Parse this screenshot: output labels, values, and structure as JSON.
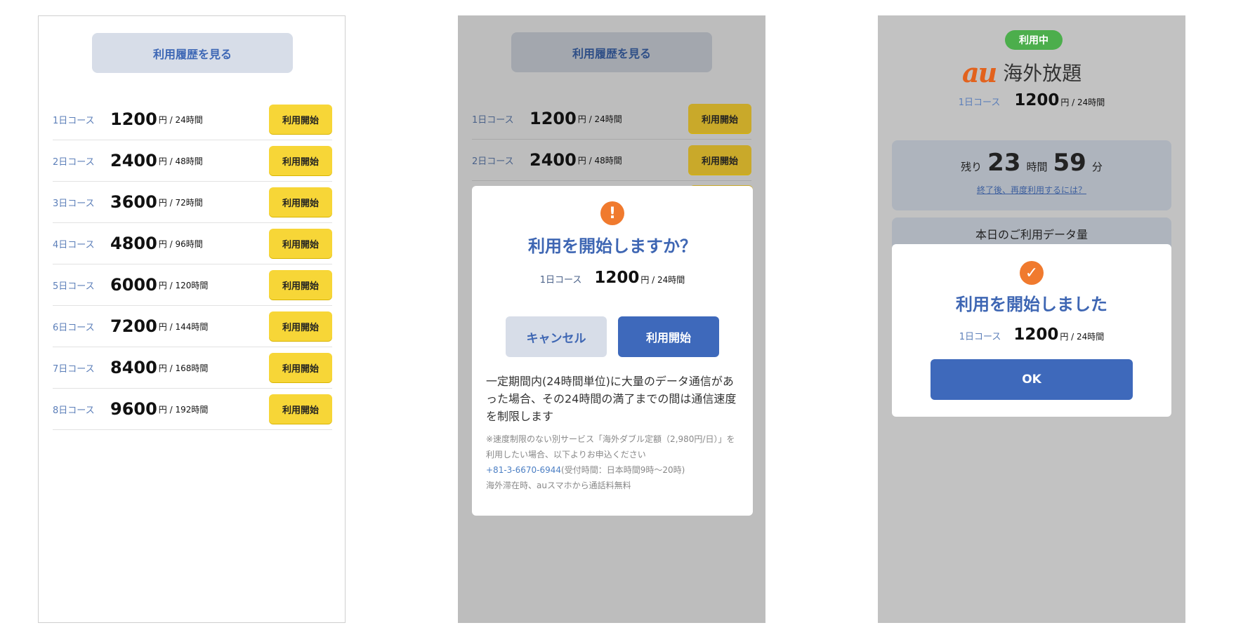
{
  "history_button": "利用履歴を見る",
  "start_label": "利用開始",
  "courses": [
    {
      "label": "1日コース",
      "price": "1200",
      "unit": "円 / 24時間"
    },
    {
      "label": "2日コース",
      "price": "2400",
      "unit": "円 / 48時間"
    },
    {
      "label": "3日コース",
      "price": "3600",
      "unit": "円 / 72時間"
    },
    {
      "label": "4日コース",
      "price": "4800",
      "unit": "円 / 96時間"
    },
    {
      "label": "5日コース",
      "price": "6000",
      "unit": "円 / 120時間"
    },
    {
      "label": "6日コース",
      "price": "7200",
      "unit": "円 / 144時間"
    },
    {
      "label": "7日コース",
      "price": "8400",
      "unit": "円 / 168時間"
    },
    {
      "label": "8日コース",
      "price": "9600",
      "unit": "円 / 192時間"
    }
  ],
  "confirm_dialog": {
    "icon": "exclamation-icon",
    "icon_glyph": "!",
    "title": "利用を開始しますか？",
    "cancel": "キャンセル",
    "confirm": "利用開始",
    "body": "一定期間内(24時間単位)に大量のデータ通信があった場合、その24時間の満了までの間は通信速度を制限します",
    "note_1": "※速度制限のない別サービス「海外ダブル定額（2,980円/日）」を利用したい場合、以下よりお申込ください",
    "phone": "+81-3-6670-6944",
    "hours": "(受付時間：日本時間9時〜20時)",
    "note_2": "海外滞在時、auスマホから通話料無料"
  },
  "status": {
    "badge": "利用中",
    "logo": "au",
    "service_name": "海外放題",
    "remaining_prefix": "残り",
    "hours": "23",
    "hours_unit": "時間",
    "minutes": "59",
    "minutes_unit": "分",
    "after_link": "終了後、再度利用するには？",
    "data_usage_title": "本日のご利用データ量"
  },
  "done_dialog": {
    "icon": "check-icon",
    "icon_glyph": "✓",
    "title": "利用を開始しました",
    "ok": "OK"
  },
  "colors": {
    "accent_blue": "#3e69bb",
    "start_yellow": "#f7d637",
    "badge_green": "#4cae4c",
    "brand_orange": "#e2621d",
    "icon_orange": "#f07a2e"
  }
}
